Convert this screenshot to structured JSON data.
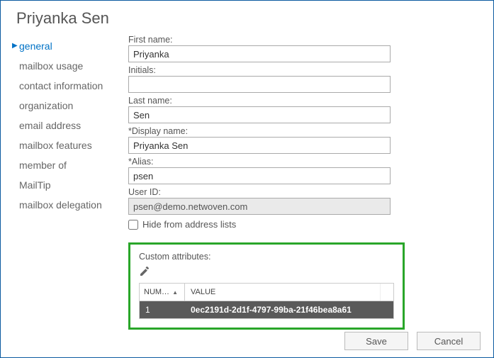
{
  "header": {
    "title": "Priyanka Sen"
  },
  "sidebar": {
    "items": [
      {
        "label": "general",
        "active": true
      },
      {
        "label": "mailbox usage",
        "active": false
      },
      {
        "label": "contact information",
        "active": false
      },
      {
        "label": "organization",
        "active": false
      },
      {
        "label": "email address",
        "active": false
      },
      {
        "label": "mailbox features",
        "active": false
      },
      {
        "label": "member of",
        "active": false
      },
      {
        "label": "MailTip",
        "active": false
      },
      {
        "label": "mailbox delegation",
        "active": false
      }
    ]
  },
  "fields": {
    "first_name": {
      "label": "First name:",
      "value": "Priyanka"
    },
    "initials": {
      "label": "Initials:",
      "value": ""
    },
    "last_name": {
      "label": "Last name:",
      "value": "Sen"
    },
    "display": {
      "label": "*Display name:",
      "value": "Priyanka Sen"
    },
    "alias": {
      "label": "*Alias:",
      "value": "psen"
    },
    "user_id": {
      "label": "User ID:",
      "value": "psen@demo.netwoven.com"
    },
    "hide": {
      "label": "Hide from address lists",
      "checked": false
    }
  },
  "custom_attributes": {
    "label": "Custom attributes:",
    "columns": {
      "num": "NUM…",
      "value": "VALUE"
    },
    "rows": [
      {
        "num": "1",
        "value": "0ec2191d-2d1f-4797-99ba-21f46bea8a61"
      }
    ]
  },
  "footer": {
    "save": "Save",
    "cancel": "Cancel"
  }
}
